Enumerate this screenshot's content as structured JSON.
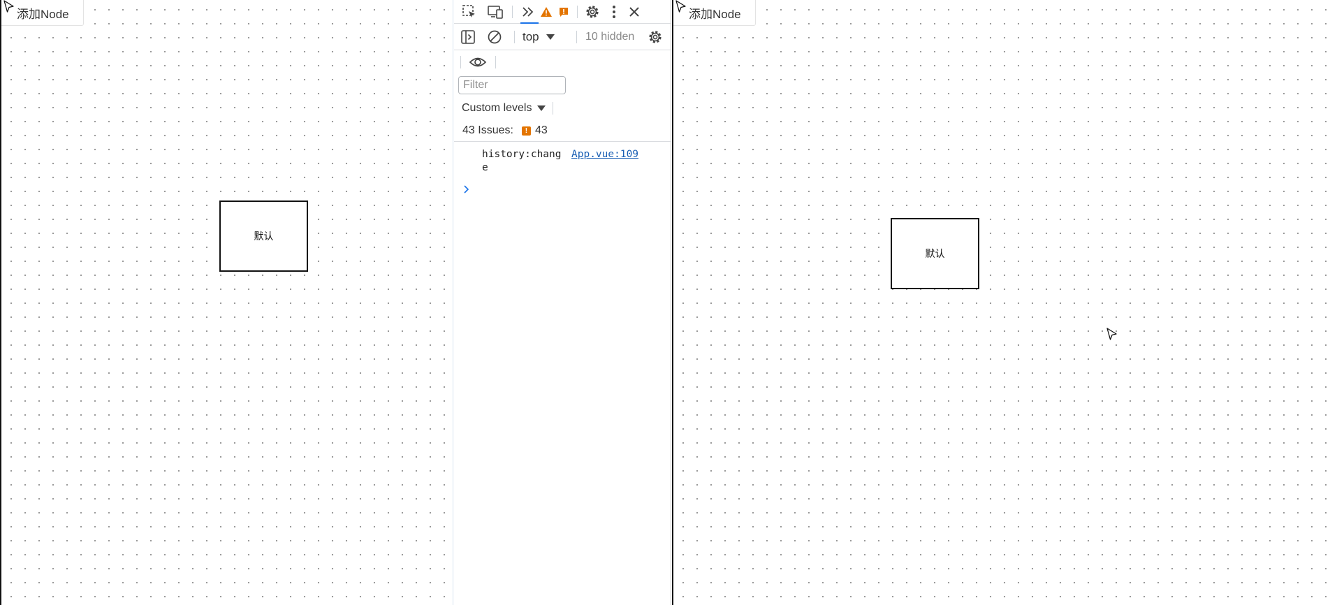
{
  "left_pane": {
    "add_node_label": "添加Node",
    "node_label": "默认"
  },
  "right_pane": {
    "add_node_label": "添加Node",
    "node_label": "默认"
  },
  "devtools": {
    "tabs_icons": [
      "inspect-element-icon",
      "device-toggle-icon",
      "more-tabs-chevron-icon",
      "warning-icon",
      "issue-icon",
      "settings-icon",
      "kebab-menu-icon",
      "close-icon"
    ],
    "context_select": "top",
    "hidden_count": "10 hidden",
    "filter_placeholder": "Filter",
    "filter_value": "",
    "levels_label": "Custom levels",
    "issues_label": "43 Issues:",
    "issues_count": "43",
    "console_messages": [
      {
        "text": "history:change",
        "source": "App.vue:109"
      }
    ],
    "colors": {
      "accent": "#1a73e8",
      "warning": "#e37400",
      "link": "#1a5fb4"
    }
  }
}
